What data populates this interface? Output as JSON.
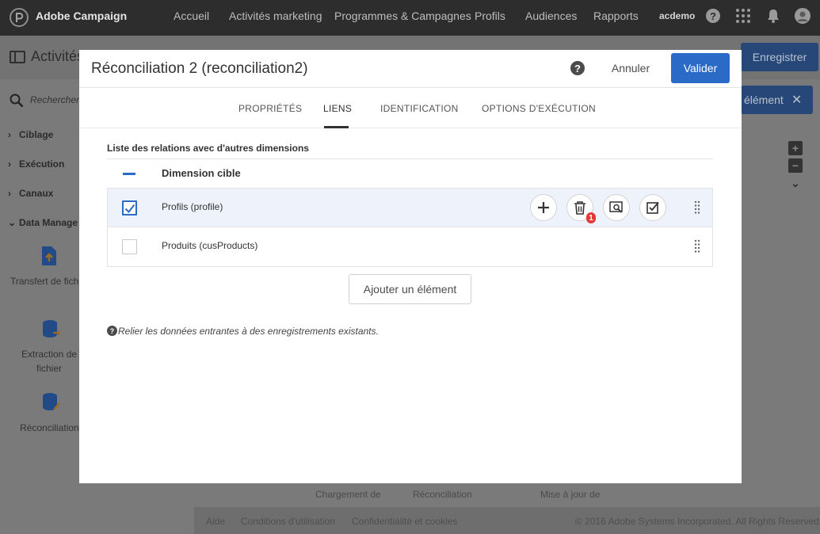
{
  "topbar": {
    "app_name": "Adobe Campaign",
    "nav": [
      "Accueil",
      "Activités marketing",
      "Programmes & Campagnes",
      "Profils",
      "Audiences",
      "Rapports"
    ],
    "user": "acdemo"
  },
  "background": {
    "title": "Activités",
    "save_button": "Enregistrer",
    "add_button": "élément",
    "search_placeholder": "Rechercher...",
    "categories": [
      "Ciblage",
      "Exécution",
      "Canaux",
      "Data Manage"
    ],
    "tiles": [
      {
        "label_1": "Transfert de fich",
        "label_2": ""
      },
      {
        "label_1": "Extraction de",
        "label_2": "fichier"
      },
      {
        "label_1": "Réconciliation",
        "label_2": ""
      }
    ],
    "bottom_labels": [
      "Chargement de",
      "Réconciliation",
      "Mise à jour de"
    ],
    "footer": {
      "links": [
        "Aide",
        "Conditions d'utilisation",
        "Confidentialité et cookies"
      ],
      "copyright": "© 2016 Adobe Systems Incorporated. All Rights Reserved"
    }
  },
  "modal": {
    "title": "Réconciliation 2 (reconciliation2)",
    "help_glyph": "?",
    "cancel_label": "Annuler",
    "validate_label": "Valider",
    "tabs": [
      {
        "label": "PROPRIÉTÉS",
        "active": false
      },
      {
        "label": "LIENS",
        "active": true
      },
      {
        "label": "IDENTIFICATION",
        "active": false
      },
      {
        "label": "OPTIONS D'EXÉCUTION",
        "active": false
      }
    ],
    "section_label": "Liste des relations avec d'autres dimensions",
    "column_title": "Dimension cible",
    "rows": [
      {
        "label": "Profils (profile)",
        "checked": true
      },
      {
        "label": "Produits (cusProducts)",
        "checked": false
      }
    ],
    "delete_badge": "1",
    "add_element_label": "Ajouter un élément",
    "hint_glyph": "?",
    "hint": "Relier les données entrantes à des enregistrements existants."
  },
  "colors": {
    "primary": "#2c6ac7",
    "badge": "#e53935",
    "selected_row": "#eef3fb"
  }
}
